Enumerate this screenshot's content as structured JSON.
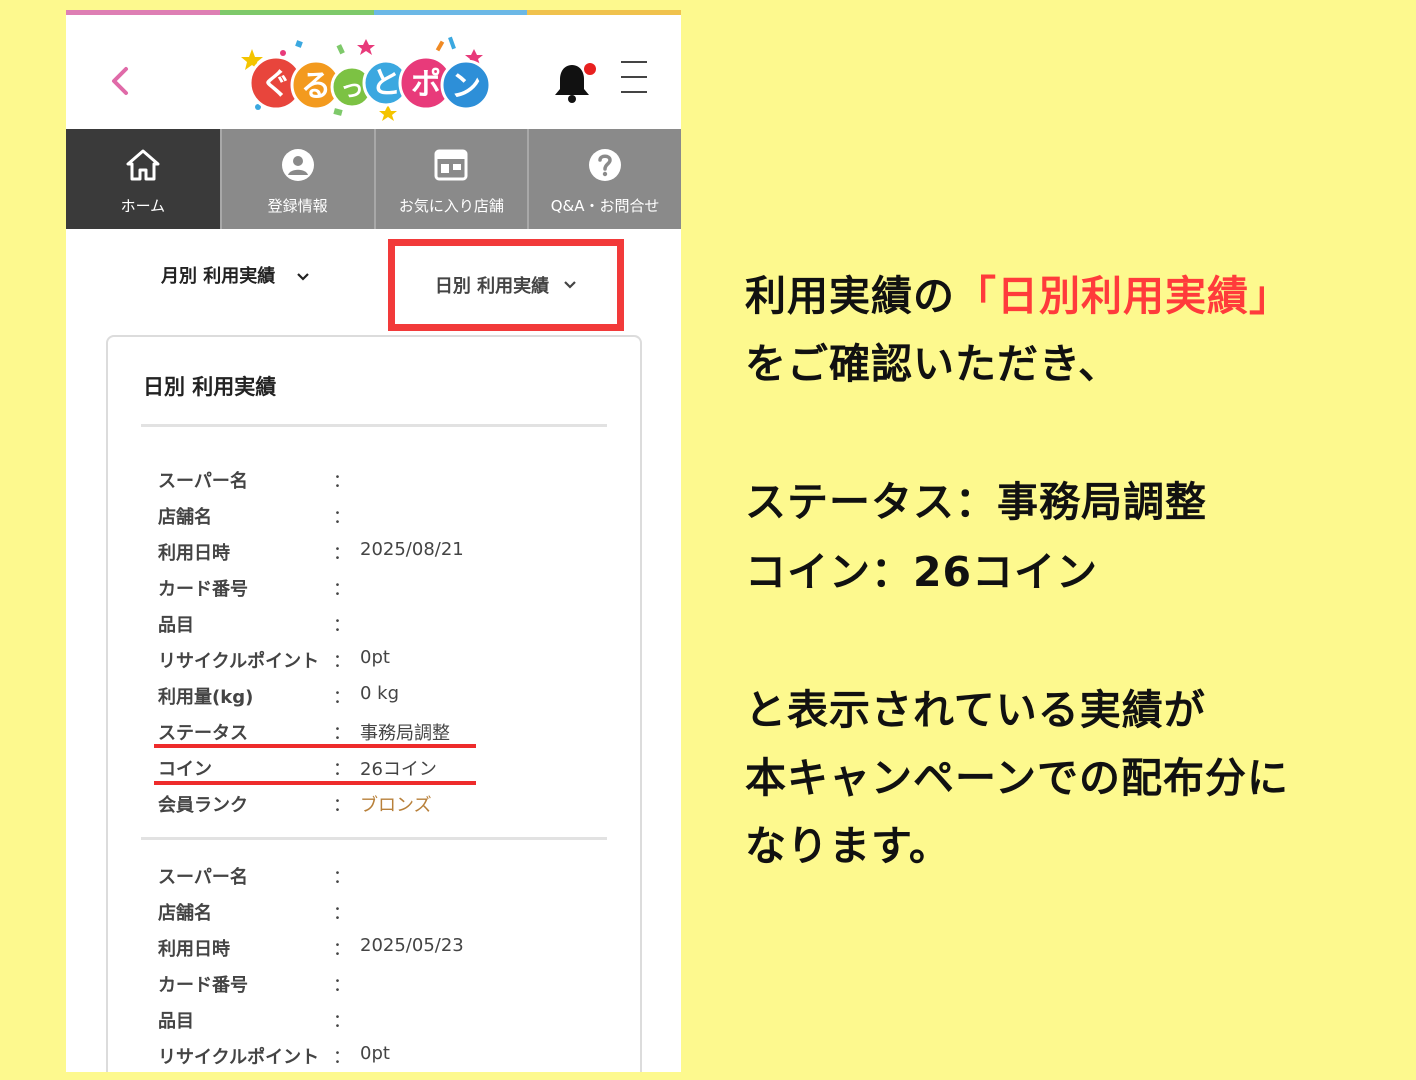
{
  "colors": {
    "background": "#fdf98e",
    "strip": [
      "#de7fb4",
      "#7ec96a",
      "#6cb8e6",
      "#f0c24d"
    ],
    "nav_active": "#3a3a3a",
    "nav_inactive": "#8a8a8a",
    "highlight_red": "#f23a3a",
    "bronze": "#b8803a"
  },
  "header": {
    "logo_text": [
      "ぐ",
      "る",
      "っ",
      "と",
      "ポ",
      "ン"
    ],
    "back_icon": "chevron-left-icon",
    "bell_icon": "bell-icon",
    "menu_icon": "hamburger-menu-icon"
  },
  "nav": [
    {
      "icon": "home-icon",
      "label": "ホーム"
    },
    {
      "icon": "user-icon",
      "label": "登録情報"
    },
    {
      "icon": "store-icon",
      "label": "お気に入り店舗"
    },
    {
      "icon": "question-icon",
      "label": "Q&A・お問合せ"
    }
  ],
  "tabs": {
    "monthly": "月別 利用実績",
    "daily": "日別 利用実績"
  },
  "card": {
    "title": "日別 利用実績",
    "colon": "：",
    "records": [
      [
        {
          "label": "スーパー名",
          "value": ""
        },
        {
          "label": "店舗名",
          "value": ""
        },
        {
          "label": "利用日時",
          "value": "2025/08/21"
        },
        {
          "label": "カード番号",
          "value": ""
        },
        {
          "label": "品目",
          "value": ""
        },
        {
          "label": "リサイクルポイント",
          "value": "0pt"
        },
        {
          "label": "利用量(kg)",
          "value": "0 kg"
        },
        {
          "label": "ステータス",
          "value": "事務局調整"
        },
        {
          "label": "コイン",
          "value": "26コイン"
        },
        {
          "label": "会員ランク",
          "value": "ブロンズ"
        }
      ],
      [
        {
          "label": "スーパー名",
          "value": ""
        },
        {
          "label": "店舗名",
          "value": ""
        },
        {
          "label": "利用日時",
          "value": "2025/05/23"
        },
        {
          "label": "カード番号",
          "value": ""
        },
        {
          "label": "品目",
          "value": ""
        },
        {
          "label": "リサイクルポイント",
          "value": "0pt"
        }
      ]
    ]
  },
  "explanation": {
    "line1_prefix": "利用実績の",
    "line1_highlight": "「日別利用実績」",
    "line2": "をご確認いただき、",
    "line3": "ステータス：事務局調整",
    "line4": "コイン：26コイン",
    "line5": "と表示されている実績が",
    "line6": "本キャンペーンでの配布分に",
    "line7": "なります。"
  }
}
